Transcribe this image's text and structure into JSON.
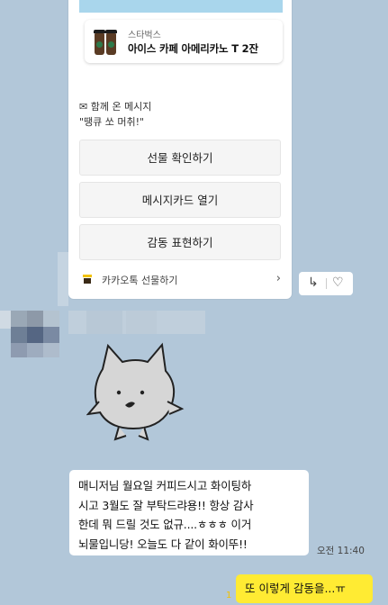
{
  "gift": {
    "brand": "스타벅스",
    "product": "아이스 카페 아메리카노 T 2잔",
    "message_label": "✉ 함께 온 메시지",
    "message": "\"땡큐 쏘 머취!\"",
    "buttons": [
      "선물 확인하기",
      "메시지카드 열기",
      "감동 표현하기"
    ],
    "footer_label": "카카오톡 선물하기",
    "footer_chevron": "›"
  },
  "actions": {
    "share": "↳",
    "like": "♡"
  },
  "chat": {
    "message_lines": [
      "매니저님 월요일 커피드시고 화이팅하",
      "시고 3월도 잘 부탁드랴용!! 항상 감사",
      "한데 뭐 드릴 것도 없규....ㅎㅎㅎ 이거",
      "뇌물입니당! 오늘도 다 같이 화이뚜!!"
    ],
    "time": "오전 11:40",
    "read_count": "1",
    "my_message": "또 이렇게 감동을...ㅠ"
  },
  "colors": {
    "background": "#b2c7d9",
    "my_bubble": "#ffeb33",
    "read_count": "#f2c200"
  }
}
